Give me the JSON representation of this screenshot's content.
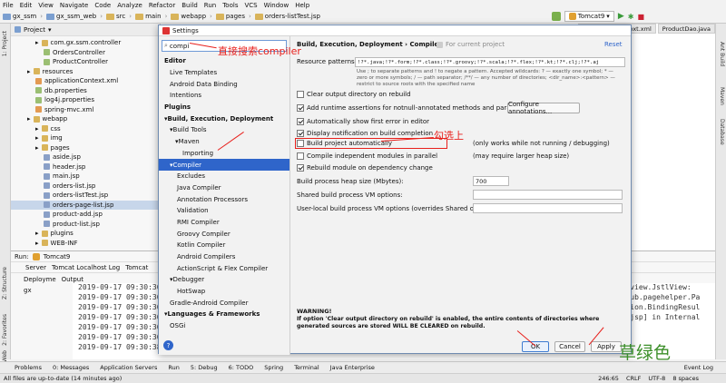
{
  "menubar": [
    "File",
    "Edit",
    "View",
    "Navigate",
    "Code",
    "Analyze",
    "Refactor",
    "Build",
    "Run",
    "Tools",
    "VCS",
    "Window",
    "Help"
  ],
  "navbar": {
    "crumbs": [
      "gx_ssm",
      "gx_ssm_web",
      "src",
      "main",
      "webapp",
      "pages",
      "orders-listTest.jsp"
    ],
    "run_config": "Tomcat9"
  },
  "left_strip": {
    "project": "1: Project",
    "structure": "Z: Structure",
    "favorites": "2: Favorites",
    "web": "Web"
  },
  "right_strip": {
    "ant": "Ant Build",
    "maven": "Maven",
    "database": "Database"
  },
  "project_panel": {
    "title": "Project",
    "tree": [
      "com.gx.ssm.controller",
      "OrdersController",
      "ProductController",
      "resources",
      "applicationContext.xml",
      "db.properties",
      "log4j.properties",
      "spring-mvc.xml",
      "webapp",
      "css",
      "img",
      "pages",
      "aside.jsp",
      "header.jsp",
      "main.jsp",
      "orders-list.jsp",
      "orders-listTest.jsp",
      "orders-page-list.jsp",
      "product-add.jsp",
      "product-list.jsp",
      "plugins",
      "WEB-INF"
    ]
  },
  "editor_tabs": [
    "applicationContext.xml",
    "ProductDao.java"
  ],
  "dialog": {
    "title": "Settings",
    "search_value": "compi",
    "search_annotation": "直接搜索compiler",
    "tree": [
      {
        "label": "Editor",
        "bold": true
      },
      {
        "label": "Live Templates"
      },
      {
        "label": "Android Data Binding"
      },
      {
        "label": "Intentions"
      },
      {
        "label": "Plugins",
        "bold": true
      },
      {
        "label": "Build, Execution, Deployment",
        "bold": true
      },
      {
        "label": "Build Tools"
      },
      {
        "label": "Maven"
      },
      {
        "label": "Importing"
      },
      {
        "label": "Compiler",
        "selected": true
      },
      {
        "label": "Excludes"
      },
      {
        "label": "Java Compiler"
      },
      {
        "label": "Annotation Processors"
      },
      {
        "label": "Validation"
      },
      {
        "label": "RMI Compiler"
      },
      {
        "label": "Groovy Compiler"
      },
      {
        "label": "Kotlin Compiler"
      },
      {
        "label": "Android Compilers"
      },
      {
        "label": "ActionScript & Flex Compiler"
      },
      {
        "label": "Debugger"
      },
      {
        "label": "HotSwap"
      },
      {
        "label": "Gradle-Android Compiler"
      },
      {
        "label": "Languages & Frameworks",
        "bold": true
      },
      {
        "label": "OSGi"
      }
    ],
    "breadcrumb": "Build, Execution, Deployment  ›  Compiler",
    "for_current_project": "For current project",
    "reset": "Reset",
    "resource_patterns_label": "Resource patterns:",
    "resource_patterns_value": "!?*.java;!?*.form;!?*.class;!?*.groovy;!?*.scala;!?*.flex;!?*.kt;!?*.clj;!?*.aj",
    "resource_hint": "Use ; to separate patterns and ! to negate a pattern. Accepted wildcards: ? — exactly one symbol; * — zero or more symbols; / — path separator; /**/ — any number of directories; <dir_name>:<pattern> — restrict to source roots with the specified name",
    "clear_output": "Clear output directory on rebuild",
    "add_runtime": "Add runtime assertions for notnull-annotated methods and parameters",
    "configure_annotations": "Configure annotations...",
    "show_first_error": "Automatically show first error in editor",
    "display_notification": "Display notification on build completion",
    "build_auto": "Build project automatically",
    "build_auto_note": "(only works while not running / debugging)",
    "build_auto_annotation": "勾选上",
    "compile_parallel": "Compile independent modules in parallel",
    "compile_parallel_note": "(may require larger heap size)",
    "rebuild_module": "Rebuild module on dependency change",
    "heap_label": "Build process heap size (Mbytes):",
    "heap_value": "700",
    "shared_vm_label": "Shared build process VM options:",
    "user_vm_label": "User-local build process VM options (overrides Shared options):",
    "warning_title": "WARNING!",
    "warning_text": "If option 'Clear output directory on rebuild' is enabled, the entire contents of directories where generated sources are stored WILL BE CLEARED on rebuild.",
    "ok": "OK",
    "cancel": "Cancel",
    "apply": "Apply",
    "help": "?"
  },
  "run_panel": {
    "title": "Run:",
    "config": "Tomcat9",
    "tabs": [
      "Server",
      "Tomcat Localhost Log",
      "Tomcat"
    ],
    "headers": [
      "Deployme",
      "Output"
    ],
    "deploy": "gx",
    "log_lines": [
      "2019-09-17 09:30:36",
      "2019-09-17 09:30:36",
      "2019-09-17 09:30:36",
      "2019-09-17 09:30:36",
      "2019-09-17 09:30:36",
      "2019-09-17 09:30:36",
      "2019-09-17 09:30:38"
    ],
    "log_tail": [
      "let.view.JstlView:",
      "github.pagehelper.Pa",
      "idation.BindingResul",
      "est.jsp] in Internal",
      ""
    ]
  },
  "bottom_tabs": [
    "Problems",
    "0: Messages",
    "Application Servers",
    "Run",
    "5: Debug",
    "6: TODO",
    "Spring",
    "Terminal",
    "Java Enterprise",
    "Event Log"
  ],
  "status": {
    "message": "All files are up-to-date (14 minutes ago)",
    "position": "246:65",
    "line_sep": "CRLF",
    "encoding": "UTF-8",
    "indent": "8 spaces"
  },
  "watermark": "草绿色",
  "colors": {
    "accent": "#2f65ca",
    "annotation": "#e8201c",
    "watermark": "#3c8f2a"
  }
}
